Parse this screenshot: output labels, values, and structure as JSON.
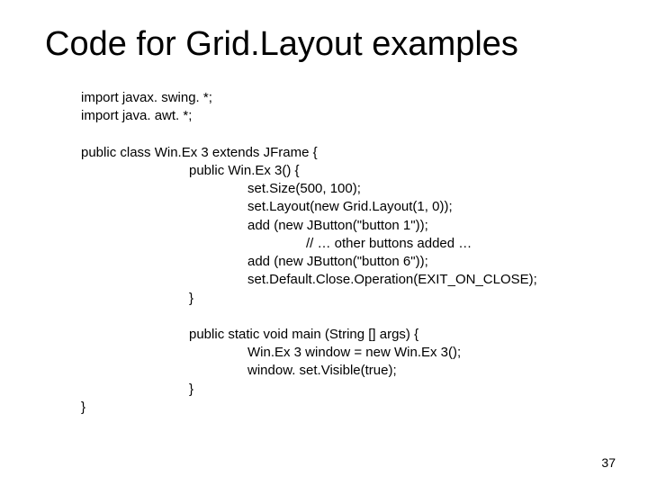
{
  "title": "Code for Grid.Layout examples",
  "code": {
    "import1": "import javax. swing. *;",
    "import2": "import java. awt. *;",
    "classDecl": "public class Win.Ex 3 extends JFrame {",
    "ctorDecl": "public Win.Ex 3() {",
    "l1": "set.Size(500, 100);",
    "l2": "set.Layout(new Grid.Layout(1, 0));",
    "l3": "add (new JButton(\"button 1\"));",
    "l4": "// … other buttons added …",
    "l5": "add (new JButton(\"button 6\"));",
    "l6": "set.Default.Close.Operation(EXIT_ON_CLOSE);",
    "ctorClose": "}",
    "mainDecl": "public static void main (String [] args) {",
    "m1": "Win.Ex 3 window = new Win.Ex 3();",
    "m2": "window. set.Visible(true);",
    "mainClose": "}",
    "classClose": "}"
  },
  "pageNumber": "37"
}
